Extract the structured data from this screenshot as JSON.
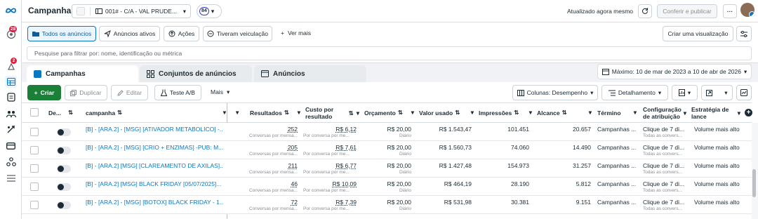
{
  "rail": {
    "notifications_badge": "28",
    "alerts_badge": "2"
  },
  "topbar": {
    "title": "Campanhas",
    "account_label": "001# - C/A - VAL PRUDE...",
    "account_badge": "84",
    "updated_text": "Atualizado agora mesmo",
    "publish_label": "Conferir e publicar",
    "more_label": "···"
  },
  "filters": {
    "all_ads": "Todos os anúncios",
    "active_ads": "Anúncios ativos",
    "actions": "Ações",
    "delivered": "Tiveram veiculação",
    "see_more": "Ver mais",
    "create_view": "Criar uma visualização"
  },
  "search": {
    "placeholder": "Pesquise para filtrar por: nome, identificação ou métrica"
  },
  "tabs": {
    "campaigns": "Campanhas",
    "adsets": "Conjuntos de anúncios",
    "ads": "Anúncios"
  },
  "date_range": "Máximo: 10 de mar de 2023 a 10 de abr de 2026",
  "toolbar": {
    "create": "Criar",
    "duplicate": "Duplicar",
    "edit": "Editar",
    "ab_test": "Teste A/B",
    "more": "Mais",
    "columns": "Colunas: Desempenho",
    "breakdown": "Detalhamento"
  },
  "columns": {
    "delivery": "De...",
    "campaign": "campanha",
    "results": "Resultados",
    "cost_per_result_1": "Custo por",
    "cost_per_result_2": "resultado",
    "budget": "Orçamento",
    "amount_spent": "Valor usado",
    "impressions": "Impressões",
    "reach": "Alcance",
    "ends": "Término",
    "attribution_1": "Configuração",
    "attribution_2": "de atribuição",
    "bid_1": "Estratégia de",
    "bid_2": "lance"
  },
  "rows": [
    {
      "name": "[B] - [ARA.2] - [MSG] [ATIVADOR METABOLICO] -...",
      "results": "252",
      "results_sub": "Conversas por mensa...",
      "cpr": "R$ 6,12",
      "cpr_sub": "Por conversa por me...",
      "budget": "R$ 20,00",
      "budget_sub": "Diário",
      "spent": "R$ 1.543,47",
      "impressions": "101.451",
      "reach": "20.657",
      "ends": "Campanhas ...",
      "attr": "Clique de 7 di...",
      "attr_sub": "Todas as convers...",
      "bid": "Volume mais alto"
    },
    {
      "name": "[B] - [ARA.2] - [MSG] [CRIO + ENZIMAS] -PUB: M...",
      "results": "205",
      "results_sub": "Conversas por mensa...",
      "cpr": "R$ 7,61",
      "cpr_sub": "Por conversa por me...",
      "budget": "R$ 20,00",
      "budget_sub": "Diário",
      "spent": "R$ 1.560,73",
      "impressions": "74.060",
      "reach": "14.490",
      "ends": "Campanhas ...",
      "attr": "Clique de 7 di...",
      "attr_sub": "Todas as convers...",
      "bid": "Volume mais alto"
    },
    {
      "name": "[B] - [ARA.2] [MSG] [CLAREAMENTO DE AXILAS]...",
      "results": "211",
      "results_sub": "Conversas por mensa...",
      "cpr": "R$ 6,77",
      "cpr_sub": "Por conversa por me...",
      "budget": "R$ 20,00",
      "budget_sub": "Diário",
      "spent": "R$ 1.427,48",
      "impressions": "154.973",
      "reach": "31.257",
      "ends": "Campanhas ...",
      "attr": "Clique de 7 di...",
      "attr_sub": "Todas as convers...",
      "bid": "Volume mais alto"
    },
    {
      "name": "[B] - [ARA.2] [MSG] BLACK FRIDAY [05/07/2025]...",
      "results": "46",
      "results_sub": "Conversas por mensa...",
      "cpr": "R$ 10,09",
      "cpr_sub": "Por conversa por me...",
      "budget": "R$ 20,00",
      "budget_sub": "Diário",
      "spent": "R$ 464,19",
      "impressions": "28.190",
      "reach": "5.812",
      "ends": "Campanhas ...",
      "attr": "Clique de 7 di...",
      "attr_sub": "Todas as convers...",
      "bid": "Volume mais alto"
    },
    {
      "name": "[B] - [ARA.2] - [MSG] [BOTOX] BLACK FRIDAY - 1...",
      "results": "72",
      "results_sub": "Conversas por mensa...",
      "cpr": "R$ 7,39",
      "cpr_sub": "Por conversa por me...",
      "budget": "R$ 20,00",
      "budget_sub": "Diário",
      "spent": "R$ 531,98",
      "impressions": "30.381",
      "reach": "9.151",
      "ends": "Campanhas ...",
      "attr": "Clique de 7 di...",
      "attr_sub": "Todas as convers...",
      "bid": "Volume mais alto"
    }
  ]
}
